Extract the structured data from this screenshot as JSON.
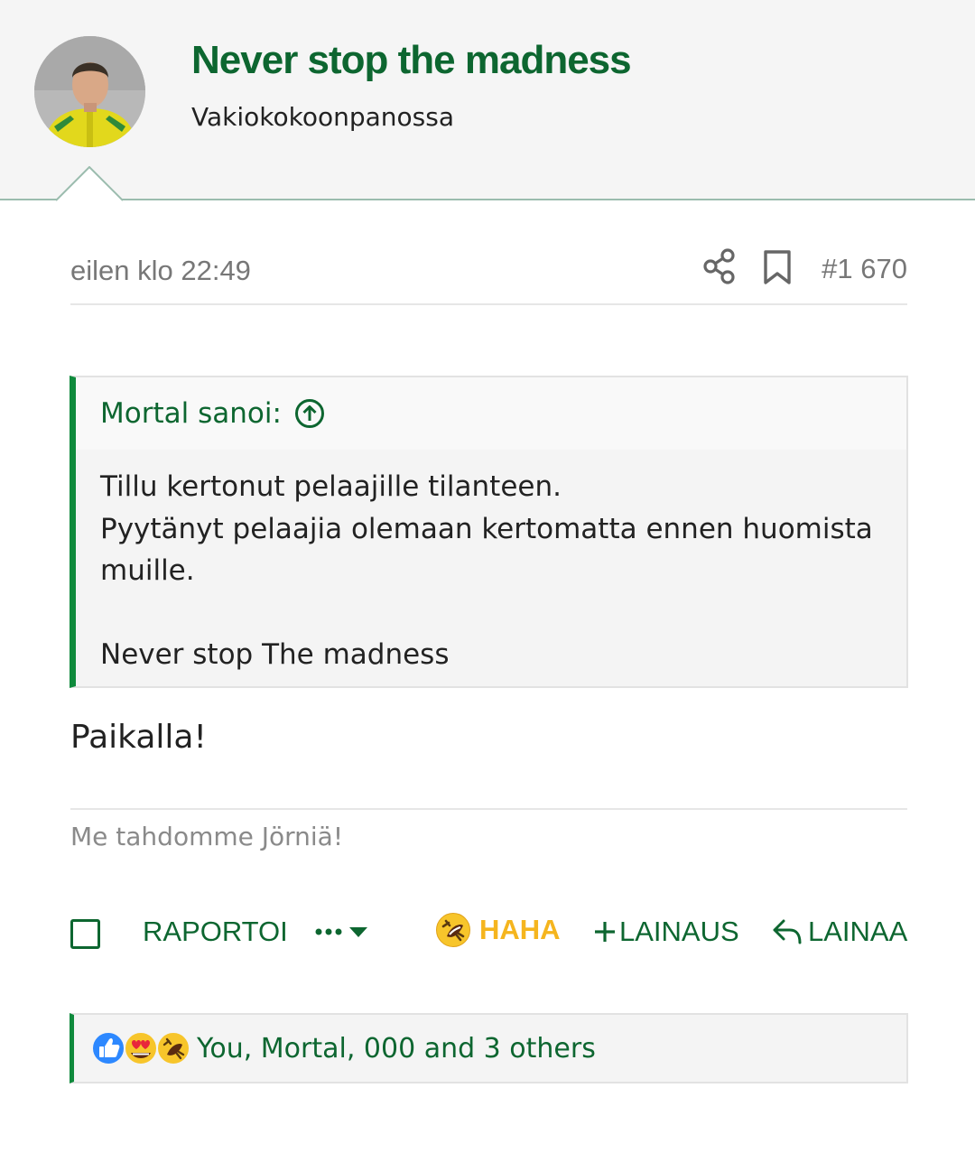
{
  "thread": {
    "title": "Never stop the madness",
    "author_rank": "Vakiokokoonpanossa"
  },
  "post": {
    "timestamp": "eilen klo 22:49",
    "number": "#1 670",
    "quote": {
      "author_label": "Mortal sanoi:",
      "lines": [
        "Tillu kertonut pelaajille tilanteen.",
        "Pyytänyt pelaajia olemaan kertomatta ennen huomista",
        "muille.",
        "",
        "Never stop The madness"
      ]
    },
    "body": "Paikalla!",
    "signature": "Me tahdomme Jörniä!"
  },
  "actions": {
    "report": "RAPORTOI",
    "more": "•••",
    "haha": "HAHA",
    "multi_quote": "LAINAUS",
    "reply": "LAINAA"
  },
  "reactions": {
    "summary": "You, Mortal, 000 and 3 others",
    "icons": [
      "like-icon",
      "heart-eyes-icon",
      "rofl-icon"
    ]
  },
  "colors": {
    "brand_green": "#0d6630",
    "accent_green": "#0f8a3c",
    "haha_yellow": "#f5b51e",
    "like_blue": "#2d88ff"
  }
}
